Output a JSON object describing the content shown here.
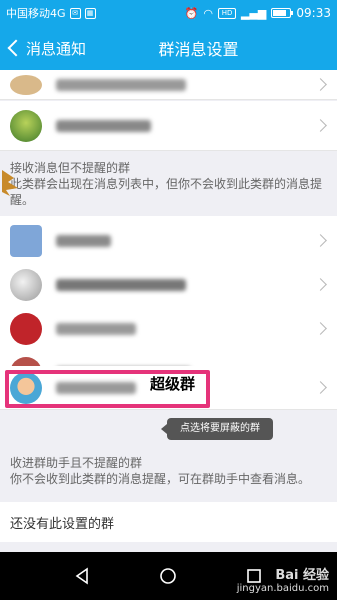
{
  "status_bar": {
    "carrier": "中国移动4G",
    "time": "09:33",
    "hd_label": "HD"
  },
  "title_bar": {
    "back_label": "消息通知",
    "title": "群消息设置"
  },
  "section_no_remind": {
    "title": "接收消息但不提醒的群",
    "desc": "此类群会出现在消息列表中，但你不会收到此类群的消息提醒。"
  },
  "super_group_label": "超级群",
  "tooltip": "点选将要屏蔽的群",
  "section_helper": {
    "title": "收进群助手且不提醒的群",
    "desc": "你不会收到此类群的消息提醒，可在群助手中查看消息。"
  },
  "no_setting": "还没有此设置的群",
  "watermark": {
    "brand": "Bai 经验",
    "url": "jingyan.baidu.com"
  },
  "colors": {
    "accent": "#15a8ea",
    "highlight": "#e5337a"
  }
}
